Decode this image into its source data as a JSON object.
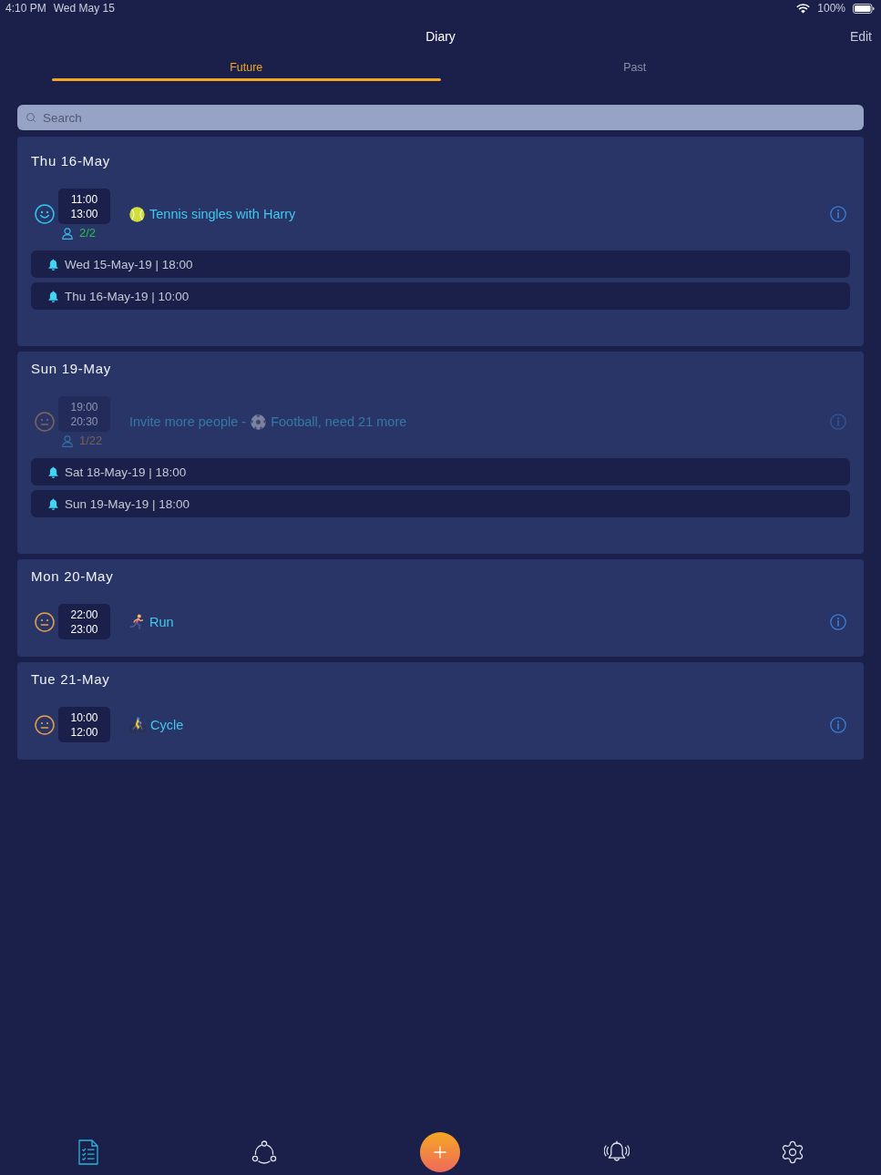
{
  "status_bar": {
    "time": "4:10 PM",
    "date": "Wed May 15",
    "battery": "100%"
  },
  "nav": {
    "title": "Diary",
    "edit": "Edit"
  },
  "tabs": [
    {
      "label": "Future",
      "selected": true
    },
    {
      "label": "Past",
      "selected": false
    }
  ],
  "search": {
    "placeholder": "Search"
  },
  "days": [
    {
      "date": "Thu 16-May",
      "events": [
        {
          "start": "11:00",
          "end": "13:00",
          "happy": true,
          "dimmed": false,
          "attendance": "2/2",
          "full": true,
          "kind": "tennis",
          "title": "Tennis singles with Harry"
        }
      ],
      "reminders": [
        "Wed 15-May-19 | 18:00",
        "Thu 16-May-19 | 10:00"
      ]
    },
    {
      "date": "Sun 19-May",
      "events": [
        {
          "start": "19:00",
          "end": "20:30",
          "happy": false,
          "dimmed": true,
          "attendance": "1/22",
          "full": false,
          "kind": "football",
          "title_prefix": "Invite more people -",
          "title": "Football, need 21 more"
        }
      ],
      "reminders": [
        "Sat 18-May-19 | 18:00",
        "Sun 19-May-19 | 18:00"
      ]
    },
    {
      "date": "Mon 20-May",
      "events": [
        {
          "start": "22:00",
          "end": "23:00",
          "happy": false,
          "dimmed": false,
          "kind": "run",
          "title": "Run"
        }
      ]
    },
    {
      "date": "Tue 21-May",
      "events": [
        {
          "start": "10:00",
          "end": "12:00",
          "happy": false,
          "dimmed": false,
          "kind": "cycle",
          "title": "Cycle"
        }
      ]
    }
  ],
  "tab_bar": [
    {
      "kind": "diary",
      "selected": true
    },
    {
      "kind": "groups",
      "selected": false
    },
    {
      "kind": "add"
    },
    {
      "kind": "alerts",
      "selected": false
    },
    {
      "kind": "settings",
      "selected": false
    }
  ]
}
